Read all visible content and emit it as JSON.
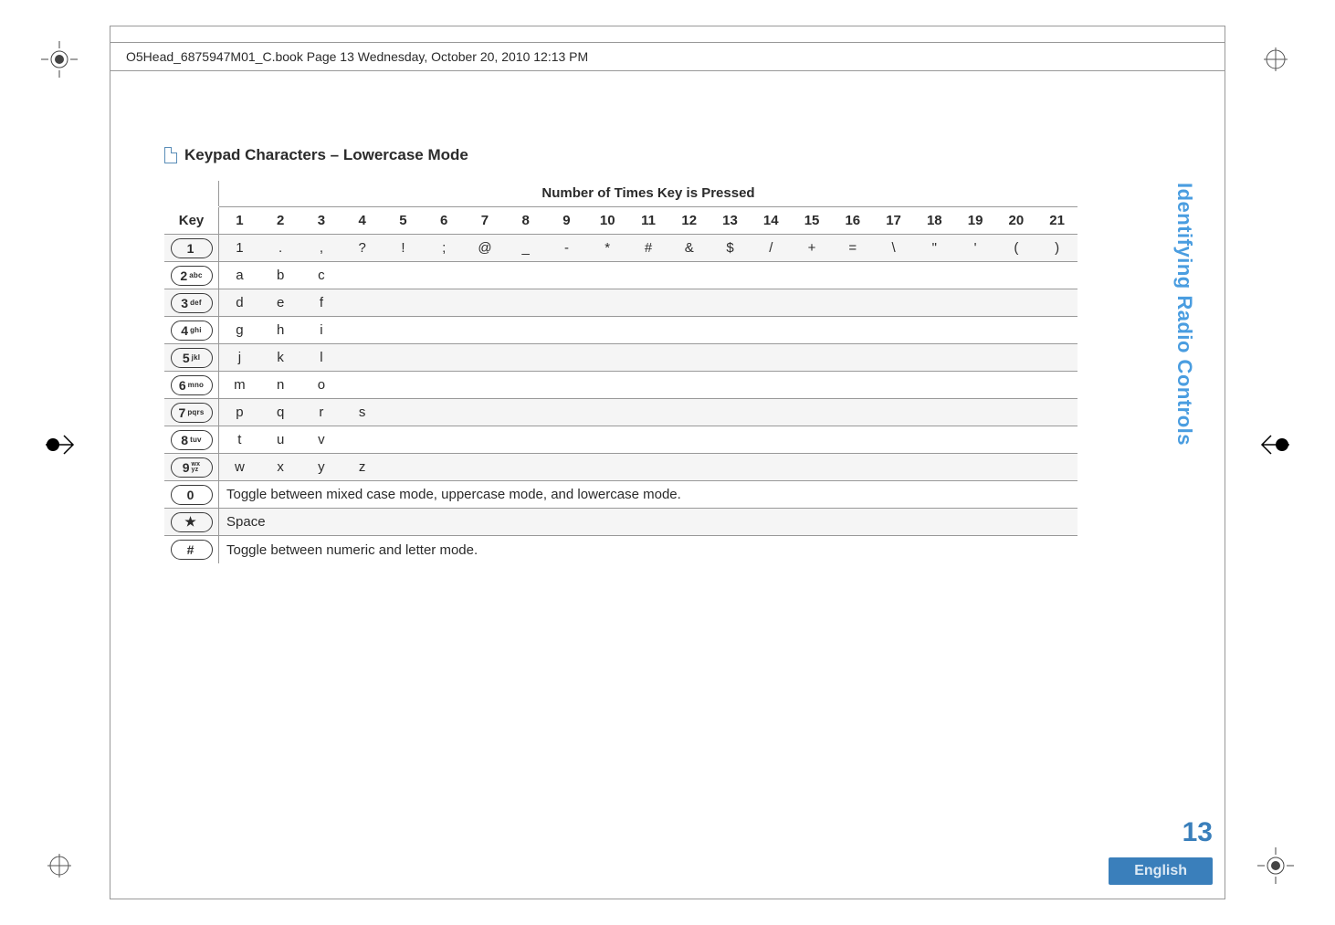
{
  "header_caption": "O5Head_6875947M01_C.book  Page 13  Wednesday, October 20, 2010  12:13 PM",
  "section_title": "Keypad Characters – Lowercase Mode",
  "chart_data": {
    "type": "table",
    "title": "Keypad Characters – Lowercase Mode",
    "super_header": "Number of Times Key is Pressed",
    "columns": [
      "Key",
      "1",
      "2",
      "3",
      "4",
      "5",
      "6",
      "7",
      "8",
      "9",
      "10",
      "11",
      "12",
      "13",
      "14",
      "15",
      "16",
      "17",
      "18",
      "19",
      "20",
      "21"
    ],
    "key_labels": {
      "k1": {
        "main": "1",
        "sub": ""
      },
      "k2": {
        "main": "2",
        "sub": "abc"
      },
      "k3": {
        "main": "3",
        "sub": "def"
      },
      "k4": {
        "main": "4",
        "sub": "ghi"
      },
      "k5": {
        "main": "5",
        "sub": "jkl"
      },
      "k6": {
        "main": "6",
        "sub": "mno"
      },
      "k7": {
        "main": "7",
        "sub": "pqrs"
      },
      "k8": {
        "main": "8",
        "sub": "tuv"
      },
      "k9": {
        "main": "9",
        "sub": "wx yz"
      },
      "k0": {
        "main": "0",
        "sub": ""
      },
      "kstar": {
        "main": "★",
        "sub": ""
      },
      "khash": {
        "main": "#",
        "sub": ""
      }
    },
    "rows": [
      {
        "key": "k1",
        "values": [
          "1",
          ".",
          ",",
          "?",
          "!",
          ";",
          "@",
          "_",
          "-",
          "*",
          "#",
          "&",
          "$",
          "/",
          "+",
          "=",
          "\\",
          "\"",
          "'",
          "(",
          ")"
        ]
      },
      {
        "key": "k2",
        "values": [
          "a",
          "b",
          "c",
          "",
          "",
          "",
          "",
          "",
          "",
          "",
          "",
          "",
          "",
          "",
          "",
          "",
          "",
          "",
          "",
          "",
          ""
        ]
      },
      {
        "key": "k3",
        "values": [
          "d",
          "e",
          "f",
          "",
          "",
          "",
          "",
          "",
          "",
          "",
          "",
          "",
          "",
          "",
          "",
          "",
          "",
          "",
          "",
          "",
          ""
        ]
      },
      {
        "key": "k4",
        "values": [
          "g",
          "h",
          "i",
          "",
          "",
          "",
          "",
          "",
          "",
          "",
          "",
          "",
          "",
          "",
          "",
          "",
          "",
          "",
          "",
          "",
          ""
        ]
      },
      {
        "key": "k5",
        "values": [
          "j",
          "k",
          "l",
          "",
          "",
          "",
          "",
          "",
          "",
          "",
          "",
          "",
          "",
          "",
          "",
          "",
          "",
          "",
          "",
          "",
          ""
        ]
      },
      {
        "key": "k6",
        "values": [
          "m",
          "n",
          "o",
          "",
          "",
          "",
          "",
          "",
          "",
          "",
          "",
          "",
          "",
          "",
          "",
          "",
          "",
          "",
          "",
          "",
          ""
        ]
      },
      {
        "key": "k7",
        "values": [
          "p",
          "q",
          "r",
          "s",
          "",
          "",
          "",
          "",
          "",
          "",
          "",
          "",
          "",
          "",
          "",
          "",
          "",
          "",
          "",
          "",
          ""
        ]
      },
      {
        "key": "k8",
        "values": [
          "t",
          "u",
          "v",
          "",
          "",
          "",
          "",
          "",
          "",
          "",
          "",
          "",
          "",
          "",
          "",
          "",
          "",
          "",
          "",
          "",
          ""
        ]
      },
      {
        "key": "k9",
        "values": [
          "w",
          "x",
          "y",
          "z",
          "",
          "",
          "",
          "",
          "",
          "",
          "",
          "",
          "",
          "",
          "",
          "",
          "",
          "",
          "",
          "",
          ""
        ]
      }
    ],
    "special_rows": [
      {
        "key": "k0",
        "text": "Toggle between mixed case mode, uppercase mode, and lowercase mode."
      },
      {
        "key": "kstar",
        "text": "Space"
      },
      {
        "key": "khash",
        "text": "Toggle between numeric and letter mode."
      }
    ]
  },
  "sidebar_text": "Identifying Radio Controls",
  "page_number": "13",
  "footer_language": "English"
}
